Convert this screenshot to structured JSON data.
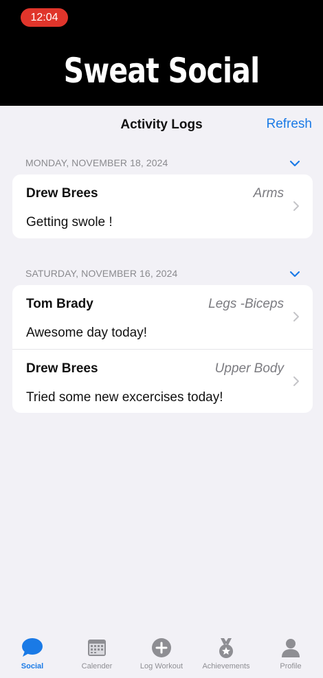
{
  "status_bar": {
    "time": "12:04"
  },
  "header": {
    "app_title": "Sweat Social"
  },
  "navbar": {
    "title": "Activity Logs",
    "refresh_label": "Refresh"
  },
  "sections": [
    {
      "date": "MONDAY, NOVEMBER 18, 2024",
      "entries": [
        {
          "name": "Drew Brees",
          "tag": "Arms",
          "message": "Getting swole !"
        }
      ]
    },
    {
      "date": "SATURDAY, NOVEMBER 16, 2024",
      "entries": [
        {
          "name": "Tom Brady",
          "tag": "Legs -Biceps",
          "message": "Awesome day today!"
        },
        {
          "name": "Drew Brees",
          "tag": "Upper Body",
          "message": "Tried some new excercises today!"
        }
      ]
    }
  ],
  "tabbar": {
    "tabs": [
      {
        "label": "Social",
        "icon": "chat-bubble-icon",
        "active": true
      },
      {
        "label": "Calender",
        "icon": "calendar-icon"
      },
      {
        "label": "Log Workout",
        "icon": "plus-circle-icon"
      },
      {
        "label": "Achievements",
        "icon": "medal-icon"
      },
      {
        "label": "Profile",
        "icon": "person-icon"
      }
    ]
  },
  "colors": {
    "accent": "#1a7ae6",
    "header_bg": "#000000",
    "status_pill": "#e0352b",
    "background": "#f2f1f6"
  }
}
